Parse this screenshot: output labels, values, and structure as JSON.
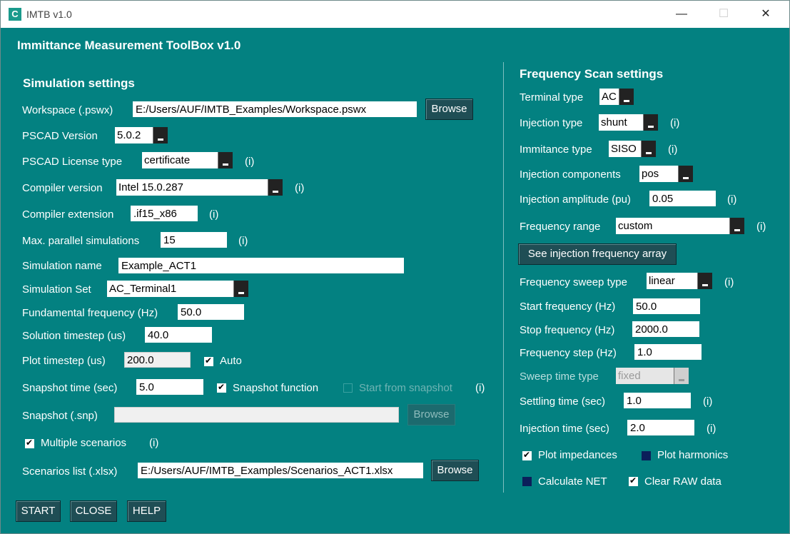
{
  "window": {
    "title": "IMTB v1.0",
    "app_icon_glyph": "C",
    "minimize_glyph": "—",
    "maximize_glyph": "☐",
    "close_glyph": "✕"
  },
  "app_title": "Immittance Measurement ToolBox v1.0",
  "info_marker": "(i)",
  "sim": {
    "header": "Simulation settings",
    "workspace_label": "Workspace (.pswx)",
    "workspace_value": "E:/Users/AUF/IMTB_Examples/Workspace.pswx",
    "browse_label": "Browse",
    "pscad_version_label": "PSCAD Version",
    "pscad_version_value": "5.0.2",
    "license_label": "PSCAD License type",
    "license_value": "certificate",
    "compiler_version_label": "Compiler version",
    "compiler_version_value": "Intel 15.0.287",
    "compiler_ext_label": "Compiler extension",
    "compiler_ext_value": ".if15_x86",
    "max_parallel_label": "Max. parallel simulations",
    "max_parallel_value": "15",
    "sim_name_label": "Simulation name",
    "sim_name_value": "Example_ACT1",
    "sim_set_label": "Simulation Set",
    "sim_set_value": "AC_Terminal1",
    "fund_freq_label": "Fundamental frequency (Hz)",
    "fund_freq_value": "50.0",
    "sol_timestep_label": "Solution timestep (us)",
    "sol_timestep_value": "40.0",
    "plot_timestep_label": "Plot timestep (us)",
    "plot_timestep_value": "200.0",
    "auto_label": "Auto",
    "snapshot_time_label": "Snapshot time (sec)",
    "snapshot_time_value": "5.0",
    "snapshot_function_label": "Snapshot function",
    "start_from_snapshot_label": "Start from snapshot",
    "snapshot_file_label": "Snapshot (.snp)",
    "snapshot_file_value": "",
    "multiple_scenarios_label": "Multiple scenarios",
    "scenarios_list_label": "Scenarios list (.xlsx)",
    "scenarios_list_value": "E:/Users/AUF/IMTB_Examples/Scenarios_ACT1.xlsx"
  },
  "freq": {
    "header": "Frequency Scan settings",
    "terminal_type_label": "Terminal type",
    "terminal_type_value": "AC",
    "injection_type_label": "Injection type",
    "injection_type_value": "shunt",
    "immitance_type_label": "Immitance type",
    "immitance_type_value": "SISO",
    "injection_components_label": "Injection components",
    "injection_components_value": "pos",
    "injection_amplitude_label": "Injection amplitude (pu)",
    "injection_amplitude_value": "0.05",
    "frequency_range_label": "Frequency range",
    "frequency_range_value": "custom",
    "see_array_label": "See injection frequency array",
    "sweep_type_label": "Frequency sweep type",
    "sweep_type_value": "linear",
    "start_freq_label": "Start frequency (Hz)",
    "start_freq_value": "50.0",
    "stop_freq_label": "Stop frequency (Hz)",
    "stop_freq_value": "2000.0",
    "freq_step_label": "Frequency step (Hz)",
    "freq_step_value": "1.0",
    "sweep_time_type_label": "Sweep time type",
    "sweep_time_type_value": "fixed",
    "settling_time_label": "Settling time (sec)",
    "settling_time_value": "1.0",
    "injection_time_label": "Injection time (sec)",
    "injection_time_value": "2.0",
    "plot_impedances_label": "Plot impedances",
    "plot_harmonics_label": "Plot harmonics",
    "calculate_net_label": "Calculate NET",
    "clear_raw_label": "Clear RAW data"
  },
  "footer": {
    "start_label": "START",
    "close_label": "CLOSE",
    "help_label": "HELP"
  }
}
